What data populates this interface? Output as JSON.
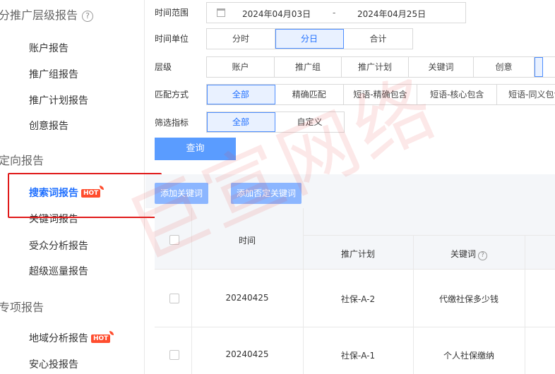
{
  "sidebar": {
    "section1_title": "分推广层级报告",
    "section1_help": "?",
    "items1": [
      "账户报告",
      "推广组报告",
      "推广计划报告",
      "创意报告"
    ],
    "section2_title": "定向报告",
    "items2": [
      "搜索词报告",
      "关键词报告",
      "受众分析报告",
      "超级巡量报告"
    ],
    "section3_title": "专项报告",
    "items3": [
      "地域分析报告",
      "安心投报告"
    ],
    "hot_badge": "HOT"
  },
  "filters": {
    "time_range_label": "时间范围",
    "date_start": "2024年04月03日",
    "date_sep": "-",
    "date_end": "2024年04月25日",
    "time_unit_label": "时间单位",
    "time_unit_options": [
      "分时",
      "分日",
      "合计"
    ],
    "level_label": "层级",
    "level_options": [
      "账户",
      "推广组",
      "推广计划",
      "关键词",
      "创意"
    ],
    "match_label": "匹配方式",
    "match_options": [
      "全部",
      "精确匹配",
      "短语-精确包含",
      "短语-核心包含",
      "短语-同义包含"
    ],
    "metric_label": "筛选指标",
    "metric_options": [
      "全部",
      "自定义"
    ],
    "query_button": "查询"
  },
  "toolbar": {
    "add_keyword": "添加关键词",
    "add_negative": "添加否定关键词"
  },
  "table": {
    "headers": {
      "time": "时间",
      "plan": "推广计划",
      "keyword": "关键词",
      "keyword_help": "?"
    },
    "rows": [
      {
        "time": "20240425",
        "plan": "社保-A-2",
        "keyword": "代缴社保多少钱"
      },
      {
        "time": "20240425",
        "plan": "社保-A-1",
        "keyword": "个人社保缴纳"
      }
    ]
  },
  "watermark": "巨宣网络",
  "colors": {
    "accent": "#1f6fff",
    "button": "#5a9cff",
    "highlight": "#e01919",
    "hot": "#ff4d2e"
  }
}
